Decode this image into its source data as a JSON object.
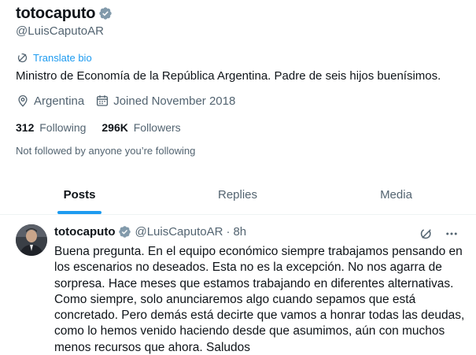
{
  "profile": {
    "display_name": "totocaputo",
    "handle": "@LuisCaputoAR",
    "translate_label": "Translate bio",
    "bio": "Ministro de Economía de la República Argentina. Padre de seis hijos buenísimos.",
    "location": "Argentina",
    "joined": "Joined November 2018",
    "following_count": "312",
    "following_label": "Following",
    "followers_count": "296K",
    "followers_label": "Followers",
    "not_followed": "Not followed by anyone you’re following"
  },
  "tabs": [
    {
      "label": "Posts",
      "active": true
    },
    {
      "label": "Replies",
      "active": false
    },
    {
      "label": "Media",
      "active": false
    }
  ],
  "tweet": {
    "author_name": "totocaputo",
    "author_handle": "@LuisCaputoAR",
    "separator": "·",
    "time": "8h",
    "lines": [
      "Buena pregunta. En el equipo económico siempre trabajamos pensando en",
      "los escenarios no deseados. Esta no es la excepción. No nos agarra de",
      "sorpresa. Hace meses que estamos trabajando en diferentes alternativas.",
      "Como siempre, solo anunciaremos algo cuando sepamos que está",
      "concretado. Pero demás está decirte que vamos a honrar todas las deudas,",
      "como lo hemos venido haciendo desde que asumimos, aún con muchos",
      "menos recursos que ahora. Saludos"
    ]
  },
  "colors": {
    "accent": "#1d9bf0",
    "text": "#0f1419",
    "muted": "#536471",
    "verified_badge": "#829aab"
  },
  "icons": [
    "verified-badge-icon",
    "translate-icon",
    "location-icon",
    "calendar-icon",
    "grok-icon",
    "more-icon"
  ]
}
